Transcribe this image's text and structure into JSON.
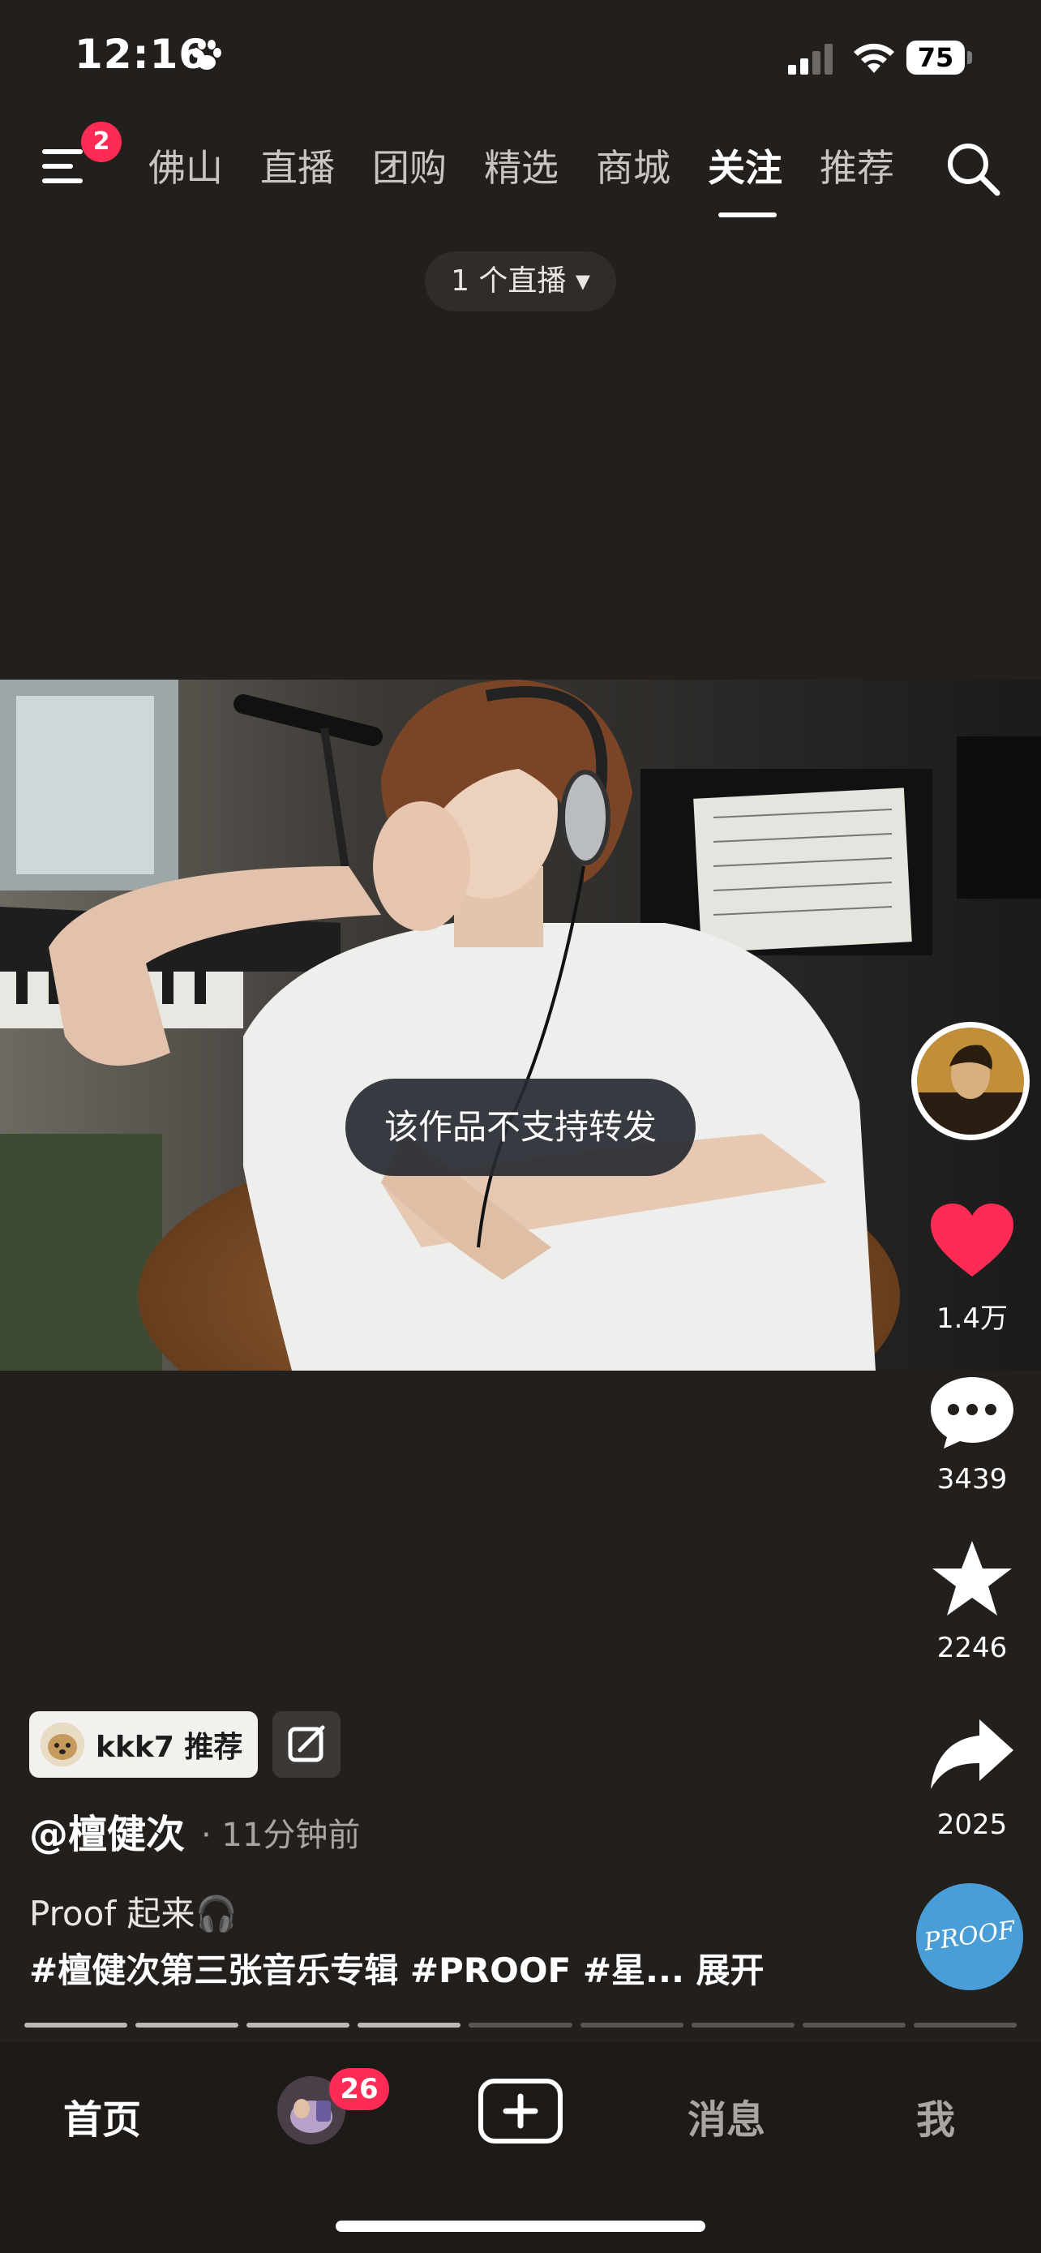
{
  "status_bar": {
    "time": "12:16",
    "battery": "75"
  },
  "top_nav": {
    "menu_badge": "2",
    "tabs": [
      "佛山",
      "直播",
      "团购",
      "精选",
      "商城",
      "关注",
      "推荐"
    ],
    "active_tab": "关注",
    "live_pill": "1 个直播 ▾"
  },
  "post": {
    "toast": "该作品不支持转发",
    "likes": "1.4万",
    "comments": "3439",
    "favorites": "2246",
    "shares": "2025",
    "recommender": "kkk7 推荐",
    "author": "@檀健次",
    "time_ago": "· 11分钟前",
    "caption_line1": "Proof 起来🎧",
    "caption_line2": "#檀健次第三张音乐专辑 #PROOF #星...",
    "expand_label": "展开",
    "music_disc_text": "PROOF",
    "progress_done": 4,
    "progress_total": 9
  },
  "bottom_nav": {
    "home": "首页",
    "friend_badge": "26",
    "messages": "消息",
    "me": "我"
  },
  "icons": {
    "paw": "paw-icon",
    "signal": "signal-icon",
    "wifi": "wifi-icon",
    "menu": "menu-icon",
    "search": "search-icon",
    "like": "heart-icon",
    "comment": "comment-icon",
    "favorite": "star-icon",
    "share": "share-icon",
    "edit": "edit-icon",
    "create": "plus-icon"
  },
  "colors": {
    "accent": "#fe2c55",
    "background": "#221f1c",
    "like": "#fe2c55"
  }
}
